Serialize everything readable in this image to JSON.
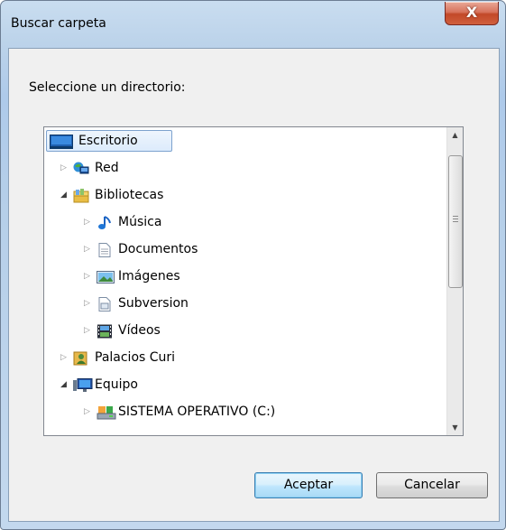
{
  "window": {
    "title": "Buscar carpeta",
    "close_glyph": "X"
  },
  "prompt": "Seleccione un directorio:",
  "tree": [
    {
      "label": "Escritorio",
      "icon": "desktop-icon",
      "level": 0,
      "toggle": "",
      "selected": true
    },
    {
      "label": "Red",
      "icon": "network-icon",
      "level": 1,
      "toggle": "closed"
    },
    {
      "label": "Bibliotecas",
      "icon": "libraries-icon",
      "level": 1,
      "toggle": "open"
    },
    {
      "label": "Música",
      "icon": "music-icon",
      "level": 2,
      "toggle": "closed"
    },
    {
      "label": "Documentos",
      "icon": "documents-icon",
      "level": 2,
      "toggle": "closed"
    },
    {
      "label": "Imágenes",
      "icon": "pictures-icon",
      "level": 2,
      "toggle": "closed"
    },
    {
      "label": "Subversion",
      "icon": "library-folder-icon",
      "level": 2,
      "toggle": "closed"
    },
    {
      "label": "Vídeos",
      "icon": "videos-icon",
      "level": 2,
      "toggle": "closed"
    },
    {
      "label": "Palacios Curi",
      "icon": "user-folder-icon",
      "level": 1,
      "toggle": "closed"
    },
    {
      "label": "Equipo",
      "icon": "computer-icon",
      "level": 1,
      "toggle": "open"
    },
    {
      "label": "SISTEMA OPERATIVO (C:)",
      "icon": "drive-icon",
      "level": 2,
      "toggle": "closed"
    }
  ],
  "scrollbar": {
    "up": "▲",
    "down": "▼"
  },
  "buttons": {
    "ok": "Aceptar",
    "cancel": "Cancelar"
  },
  "colors": {
    "selection_border": "#7da2ce",
    "close_red": "#c24828",
    "default_button": "#3c7fb1"
  }
}
